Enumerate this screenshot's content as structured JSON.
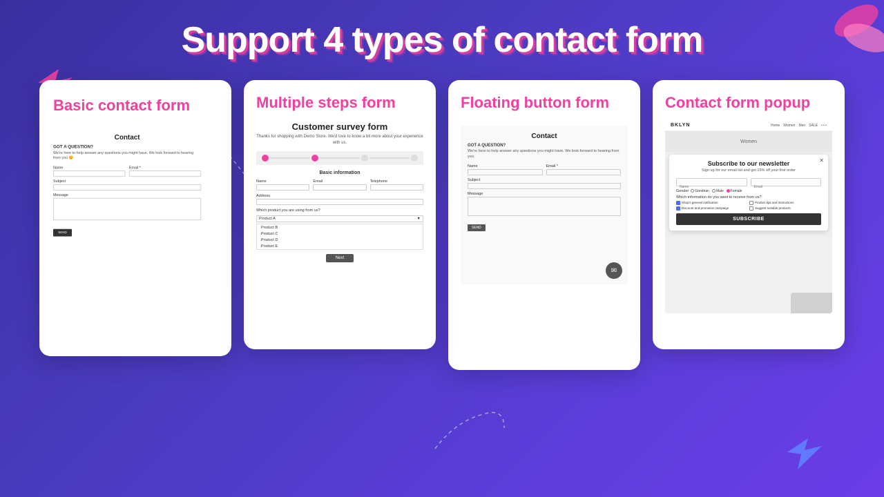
{
  "page": {
    "title": "Support 4 types of contact form",
    "background_color": "#4b3bc0"
  },
  "cards": [
    {
      "id": "basic",
      "title": "Basic contact form",
      "form": {
        "title": "Contact",
        "subtitle": "GOT A QUESTION?",
        "description": "We're here to help answer any questions you might have. We look forward to hearing from you 😊",
        "fields": [
          "Name",
          "Email *",
          "Subject",
          "Message"
        ],
        "button": "SEND"
      }
    },
    {
      "id": "multistep",
      "title": "Multiple steps form",
      "form": {
        "title": "Customer survey form",
        "description": "Thanks for shopping with Demo Store. We'd love to know a bit more about your experience with us.",
        "section": "Basic information",
        "fields": [
          "Name",
          "Email",
          "Telephone",
          "Address"
        ],
        "dropdown_label": "Which product you are using from us?",
        "dropdown_default": "Product A",
        "dropdown_options": [
          "Product B",
          "Product C",
          "Product D",
          "Product E"
        ],
        "button": "Next"
      }
    },
    {
      "id": "floating",
      "title": "Floating button form",
      "form": {
        "title": "Contact",
        "subtitle": "GOT A QUESTION?",
        "description": "We're here to help answer any questions you might have. We look forward to hearing from you.",
        "fields": [
          "Name",
          "Email *",
          "Subject",
          "Message"
        ],
        "button": "SEND",
        "chat_button": "💬"
      }
    },
    {
      "id": "popup",
      "title": "Contact form popup",
      "store": {
        "logo": "BKLYN",
        "nav": [
          "Home",
          "Women",
          "Men",
          "SALE"
        ],
        "page": "Women"
      },
      "modal": {
        "title": "Subscribe to our newsletter",
        "description": "Sign up for our email list and get 15% off your first order",
        "fields": [
          "Name",
          "Email"
        ],
        "gender_label": "Gender",
        "gender_options": [
          "Gondrian",
          "Male",
          "Female"
        ],
        "gender_selected": "Female",
        "checkbox_label": "Which information do you want to receive from us?",
        "checkboxes": [
          {
            "label": "Shop's general notification",
            "checked": true
          },
          {
            "label": "Product tips and instructions",
            "checked": false
          },
          {
            "label": "Discount and promotion campaign",
            "checked": true
          },
          {
            "label": "Suggest suitable products",
            "checked": false
          }
        ],
        "button": "SUBSCRIBE"
      }
    }
  ]
}
